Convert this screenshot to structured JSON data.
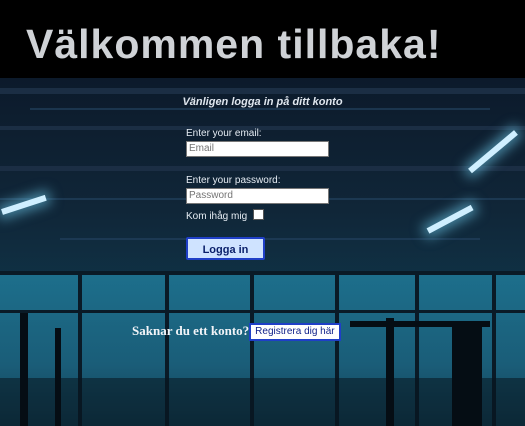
{
  "header": {
    "title": "Välkommen tillbaka!"
  },
  "login": {
    "subtitle": "Vänligen logga in på ditt konto",
    "email_label": "Enter your email:",
    "email_placeholder": "Email",
    "password_label": "Enter your password:",
    "password_placeholder": "Password",
    "remember_label": "Kom ihåg mig",
    "submit_label": "Logga in"
  },
  "signup": {
    "prompt": "Saknar du ett konto?",
    "button_label": "Registrera dig här"
  }
}
